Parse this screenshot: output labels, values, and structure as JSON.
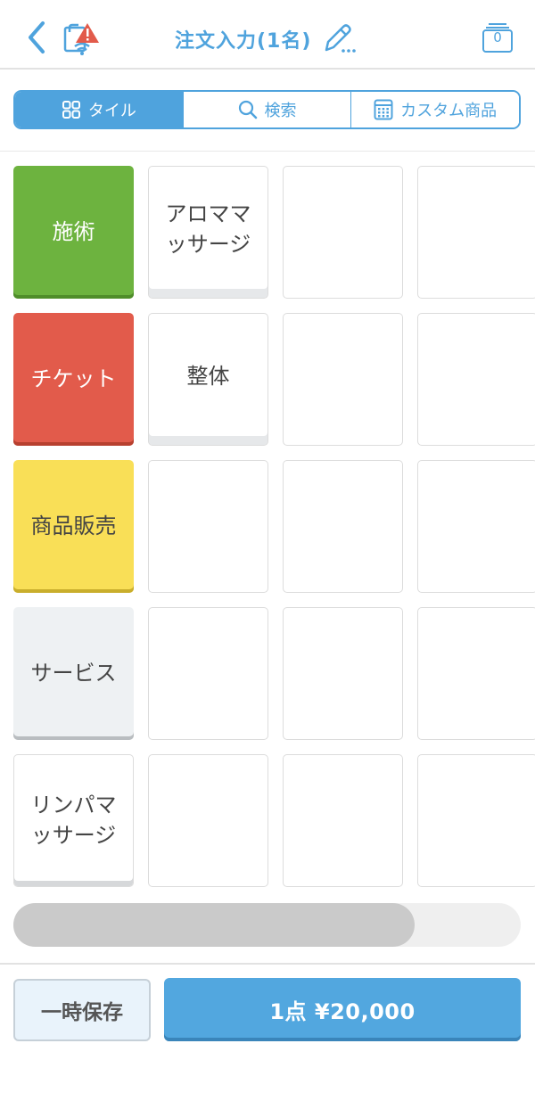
{
  "header": {
    "title": "注文入力(1名)",
    "cart_count": "0"
  },
  "tabs": [
    {
      "label": "タイル",
      "icon": "grid-icon",
      "active": true
    },
    {
      "label": "検索",
      "icon": "search-icon",
      "active": false
    },
    {
      "label": "カスタム商品",
      "icon": "calculator-icon",
      "active": false
    }
  ],
  "categories": [
    {
      "label": "施術",
      "color": "#6db33f"
    },
    {
      "label": "チケット",
      "color": "#e25b4b"
    },
    {
      "label": "商品販売",
      "color": "#f9df57"
    },
    {
      "label": "サービス",
      "color": "#eef1f3"
    },
    {
      "label": "リンパマッサージ",
      "color": "#ffffff"
    }
  ],
  "products": [
    {
      "label": "アロママッサージ"
    },
    {
      "label": "整体"
    }
  ],
  "scroll": {
    "thumb_fraction": 0.79
  },
  "footer": {
    "save_label": "一時保存",
    "total_label": "1点 ¥20,000"
  },
  "colors": {
    "accent": "#4fa3dd"
  }
}
